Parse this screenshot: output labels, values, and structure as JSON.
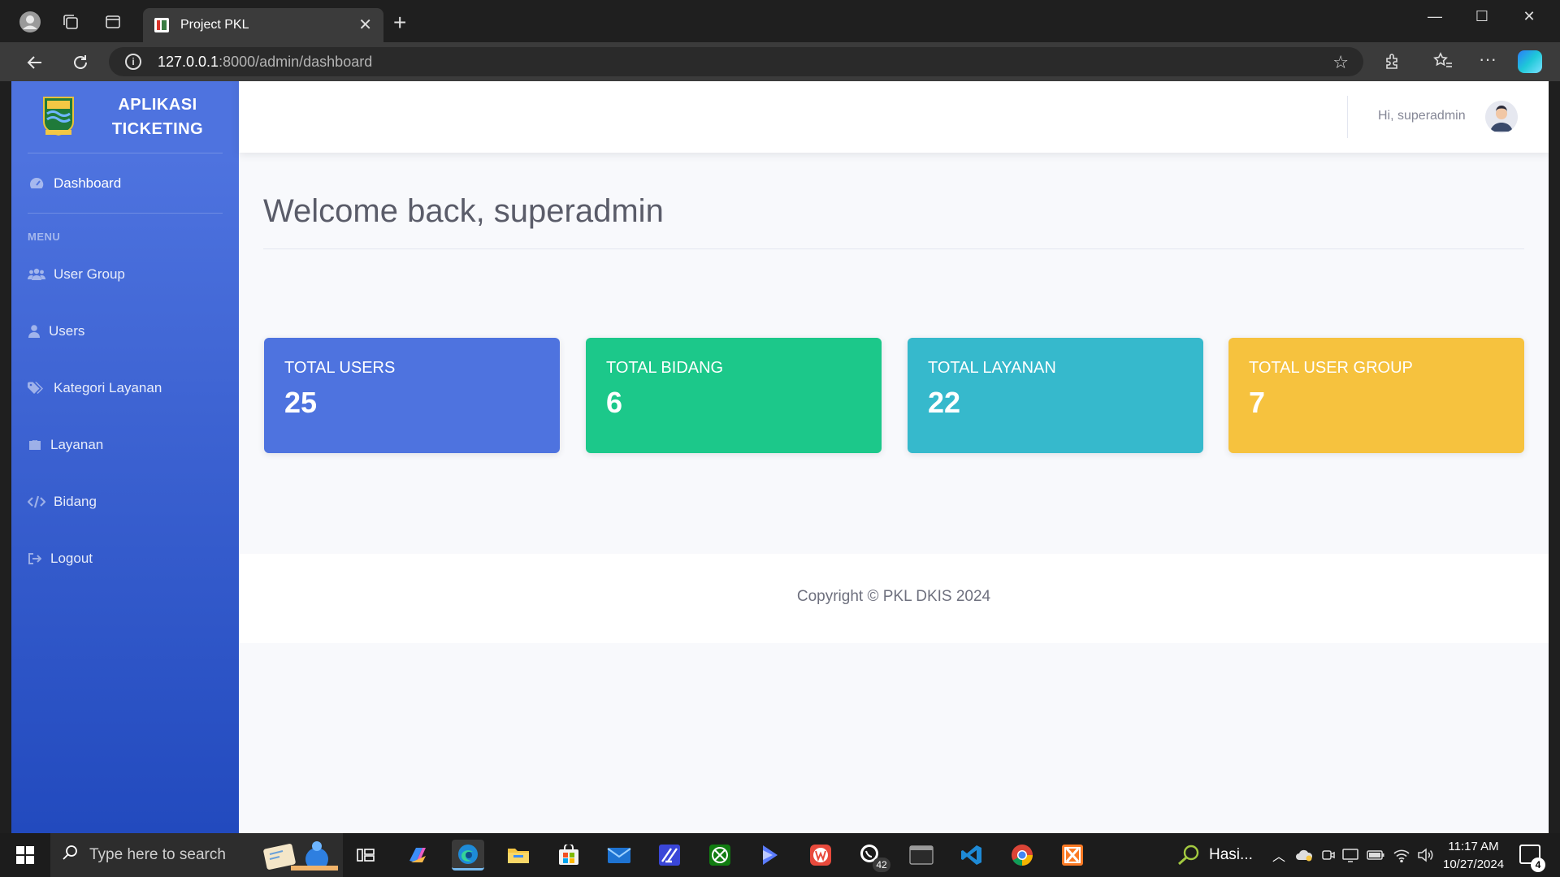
{
  "browser": {
    "tab_title": "Project PKL",
    "url_host": "127.0.0.1",
    "url_path": ":8000/admin/dashboard"
  },
  "sidebar": {
    "brand_line1": "APLIKASI",
    "brand_line2": "TICKETING",
    "dashboard": "Dashboard",
    "menu_heading": "MENU",
    "items": [
      {
        "label": "User Group",
        "icon": "users-icon"
      },
      {
        "label": "Users",
        "icon": "user-icon"
      },
      {
        "label": "Kategori Layanan",
        "icon": "tags-icon"
      },
      {
        "label": "Layanan",
        "icon": "briefcase-icon"
      },
      {
        "label": "Bidang",
        "icon": "code-icon"
      },
      {
        "label": "Logout",
        "icon": "sign-out-icon"
      }
    ]
  },
  "topbar": {
    "greeting": "Hi, superadmin"
  },
  "main": {
    "title": "Welcome back, superadmin",
    "cards": [
      {
        "label": "TOTAL USERS",
        "value": "25",
        "color": "#4e73df"
      },
      {
        "label": "TOTAL BIDANG",
        "value": "6",
        "color": "#1cc88a"
      },
      {
        "label": "TOTAL LAYANAN",
        "value": "22",
        "color": "#36b9cc"
      },
      {
        "label": "TOTAL USER GROUP",
        "value": "7",
        "color": "#f6c23e"
      }
    ]
  },
  "footer": {
    "copyright": "Copyright © PKL DKIS 2024"
  },
  "taskbar": {
    "search_placeholder": "Type here to search",
    "whatsapp_badge": "42",
    "tray_app_label": "Hasi...",
    "time": "11:17 AM",
    "date": "10/27/2024",
    "notifications": "4"
  }
}
